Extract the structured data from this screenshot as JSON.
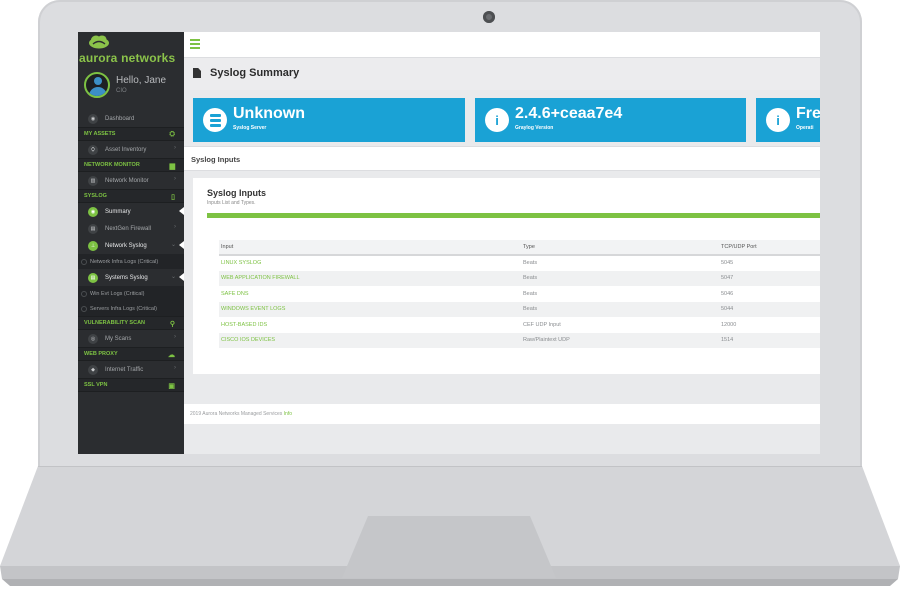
{
  "app": {
    "brand": "aurora networks",
    "greeting": "Hello, Jane",
    "role": "CIO"
  },
  "sidebar": {
    "items": [
      {
        "kind": "item",
        "label": "Dashboard",
        "icon": "dashboard-icon"
      },
      {
        "kind": "section",
        "label": "MY ASSETS",
        "icon": "assets-icon"
      },
      {
        "kind": "item",
        "label": "Asset Inventory",
        "icon": "inventory-icon"
      },
      {
        "kind": "section",
        "label": "NETWORK MONITOR",
        "icon": "monitor-icon"
      },
      {
        "kind": "item",
        "label": "Network Monitor",
        "icon": "chart-icon"
      },
      {
        "kind": "section",
        "label": "SYSLOG",
        "icon": "document-icon"
      },
      {
        "kind": "item",
        "label": "Summary",
        "icon": "summary-icon",
        "active": true
      },
      {
        "kind": "item",
        "label": "NextGen Firewall",
        "icon": "firewall-icon"
      },
      {
        "kind": "item",
        "label": "Network Syslog",
        "icon": "network-icon",
        "active": true
      },
      {
        "kind": "sub",
        "label": "Network Infra Logs (Critical)"
      },
      {
        "kind": "item",
        "label": "Systems Syslog",
        "icon": "systems-icon",
        "active": true
      },
      {
        "kind": "sub",
        "label": "Win Evt Logs (Critical)"
      },
      {
        "kind": "sub",
        "label": "Servers Infra Logs (Critical)"
      },
      {
        "kind": "section",
        "label": "VULNERABILITY SCAN",
        "icon": "search-icon"
      },
      {
        "kind": "item",
        "label": "My Scans",
        "icon": "scan-icon"
      },
      {
        "kind": "section",
        "label": "WEB PROXY",
        "icon": "cloud-icon"
      },
      {
        "kind": "item",
        "label": "Internet Traffic",
        "icon": "globe-icon"
      },
      {
        "kind": "section",
        "label": "SSL VPN",
        "icon": "lock-icon"
      }
    ]
  },
  "page": {
    "title": "Syslog Summary"
  },
  "stats": [
    {
      "value": "Unknown",
      "label": "Syslog Server",
      "icon": "server-icon"
    },
    {
      "value": "2.4.6+ceaa7e4",
      "label": "Graylog Version",
      "icon": "info-icon"
    },
    {
      "value": "Fre",
      "label": "Operati",
      "icon": "info-icon"
    }
  ],
  "inputs_bar": {
    "label": "Syslog Inputs"
  },
  "card": {
    "title": "Syslog Inputs",
    "subtitle": "Inputs List and Types.",
    "columns": [
      "Input",
      "Type",
      "TCP/UDP Port"
    ],
    "rows": [
      [
        "LINUX SYSLOG",
        "Beats",
        "5045"
      ],
      [
        "WEB APPLICATION FIREWALL",
        "Beats",
        "5047"
      ],
      [
        "SAFE DNS",
        "Beats",
        "5046"
      ],
      [
        "WINDOWS EVENT LOGS",
        "Beats",
        "5044"
      ],
      [
        "HOST-BASED IDS",
        "CEF UDP Input",
        "12000"
      ],
      [
        "CISCO IOS DEVICES",
        "Raw/Plaintext UDP",
        "1514"
      ]
    ]
  },
  "footer": {
    "text": "2019 Aurora Networks Managed Services",
    "link": "Info"
  },
  "colors": {
    "accent": "#7dc243",
    "stat": "#1aa2d5",
    "sidebar": "#2b2d30"
  }
}
